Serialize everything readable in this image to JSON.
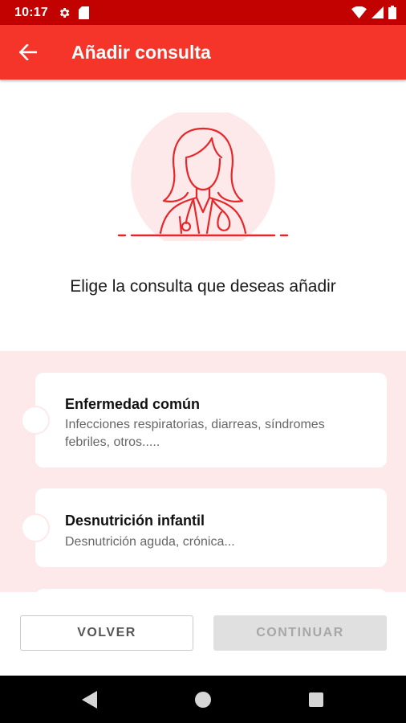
{
  "status_bar": {
    "time": "10:17",
    "left_icons": [
      "gear-icon",
      "sd-card-icon"
    ],
    "right_icons": [
      "wifi-icon",
      "signal-icon",
      "battery-icon"
    ]
  },
  "app_bar": {
    "title": "Añadir consulta",
    "back_icon": "arrow-left-icon",
    "color": "#f5352a"
  },
  "hero": {
    "illustration": "female-doctor-icon",
    "accent_color": "#e8262a"
  },
  "prompt": "Elige la consulta que deseas añadir",
  "options": [
    {
      "title": "Enfermedad común",
      "description": "Infecciones respiratorias, diarreas, síndromes febriles, otros.....",
      "selected": false
    },
    {
      "title": "Desnutrición infantil",
      "description": "Desnutrición aguda, crónica...",
      "selected": false
    }
  ],
  "buttons": {
    "back_label": "VOLVER",
    "continue_label": "CONTINUAR",
    "continue_enabled": false
  },
  "nav_bar": {
    "icons": [
      "back-triangle-icon",
      "home-circle-icon",
      "recents-square-icon"
    ]
  }
}
